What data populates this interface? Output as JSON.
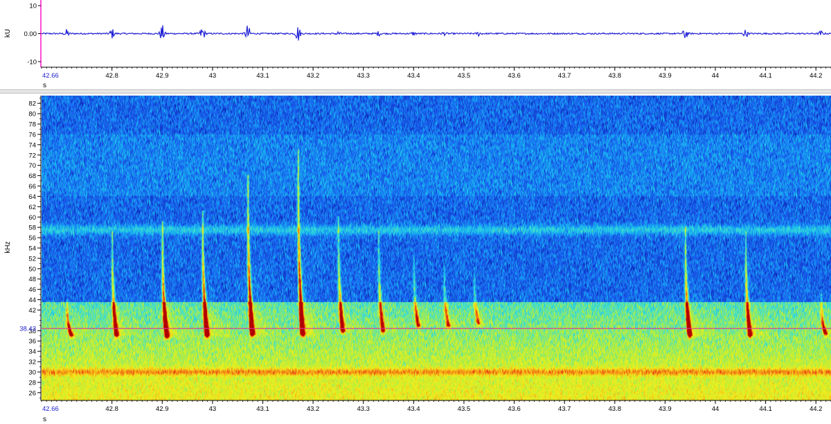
{
  "chart_data": [
    {
      "type": "line",
      "panel": "waveform",
      "xlabel": "s",
      "ylabel": "kU",
      "xlim": [
        42.66,
        44.23
      ],
      "ylim": [
        -12,
        12
      ],
      "x_ticks": [
        "42.8",
        "42.9",
        "43",
        "43.1",
        "43.2",
        "43.3",
        "43.4",
        "43.5",
        "43.6",
        "43.7",
        "43.8",
        "43.9",
        "44",
        "44.1",
        "44.2"
      ],
      "x_start_label": "42.66",
      "y_ticks": [
        "10",
        "0.00",
        "-10"
      ],
      "baseline": 0,
      "series": [
        {
          "color": "#1f1fd6",
          "bursts": [
            {
              "x": 42.71,
              "amp": 1.4
            },
            {
              "x": 42.8,
              "amp": 1.8
            },
            {
              "x": 42.9,
              "amp": 3.0
            },
            {
              "x": 42.98,
              "amp": 2.8
            },
            {
              "x": 43.07,
              "amp": 3.2
            },
            {
              "x": 43.17,
              "amp": 3.0
            },
            {
              "x": 43.25,
              "amp": 0.8
            },
            {
              "x": 43.33,
              "amp": 0.7
            },
            {
              "x": 43.4,
              "amp": 0.6
            },
            {
              "x": 43.46,
              "amp": 0.5
            },
            {
              "x": 43.53,
              "amp": 0.8
            },
            {
              "x": 43.94,
              "amp": 2.2
            },
            {
              "x": 44.06,
              "amp": 1.4
            },
            {
              "x": 44.21,
              "amp": 0.9
            }
          ]
        }
      ],
      "grid": false
    },
    {
      "type": "heatmap",
      "panel": "spectrogram",
      "xlabel": "s",
      "ylabel": "kHz",
      "xlim": [
        42.66,
        44.23
      ],
      "ylim": [
        24.5,
        83.5
      ],
      "x_ticks": [
        "42.8",
        "42.9",
        "43",
        "43.1",
        "43.2",
        "43.3",
        "43.4",
        "43.5",
        "43.6",
        "43.7",
        "43.8",
        "43.9",
        "44",
        "44.1",
        "44.2"
      ],
      "x_start_label": "42.66",
      "y_ticks": [
        "26",
        "28",
        "30",
        "32",
        "34",
        "36",
        "38",
        "42",
        "44",
        "46",
        "48",
        "50",
        "52",
        "54",
        "56",
        "58",
        "60",
        "62",
        "64",
        "66",
        "68",
        "70",
        "72",
        "74",
        "76",
        "78",
        "80",
        "82"
      ],
      "cursor_frequency_label": "38.43",
      "cursor_frequency": 38.43,
      "cursor_color": "#e0309a",
      "bands": [
        {
          "freq": 30,
          "level": "high"
        },
        {
          "freq": 57.5,
          "level": "medium"
        }
      ],
      "calls": [
        {
          "x": 42.71,
          "top_freq": 44,
          "end_freq": 37.2,
          "strength": 0.7
        },
        {
          "x": 42.8,
          "top_freq": 57,
          "end_freq": 37.2,
          "strength": 0.8
        },
        {
          "x": 42.9,
          "top_freq": 59,
          "end_freq": 37.0,
          "strength": 1.0
        },
        {
          "x": 42.98,
          "top_freq": 61,
          "end_freq": 37.2,
          "strength": 1.0
        },
        {
          "x": 43.07,
          "top_freq": 68,
          "end_freq": 37.4,
          "strength": 1.0
        },
        {
          "x": 43.17,
          "top_freq": 73,
          "end_freq": 37.4,
          "strength": 1.0
        },
        {
          "x": 43.25,
          "top_freq": 60,
          "end_freq": 38.0,
          "strength": 0.7
        },
        {
          "x": 43.33,
          "top_freq": 57,
          "end_freq": 38.0,
          "strength": 0.6
        },
        {
          "x": 43.4,
          "top_freq": 52,
          "end_freq": 39.0,
          "strength": 0.5
        },
        {
          "x": 43.46,
          "top_freq": 51,
          "end_freq": 39.0,
          "strength": 0.45
        },
        {
          "x": 43.52,
          "top_freq": 50,
          "end_freq": 39.5,
          "strength": 0.4
        },
        {
          "x": 43.94,
          "top_freq": 58,
          "end_freq": 37.2,
          "strength": 0.9
        },
        {
          "x": 44.06,
          "top_freq": 57,
          "end_freq": 37.2,
          "strength": 0.8
        },
        {
          "x": 44.21,
          "top_freq": 45,
          "end_freq": 37.5,
          "strength": 0.6
        }
      ],
      "colormap": [
        "#0a1fa8",
        "#1a5cf0",
        "#16b6f2",
        "#3fe0d0",
        "#b4ee3a",
        "#f4f01c",
        "#f4a016",
        "#e83014",
        "#b00000"
      ],
      "grid": false
    }
  ]
}
